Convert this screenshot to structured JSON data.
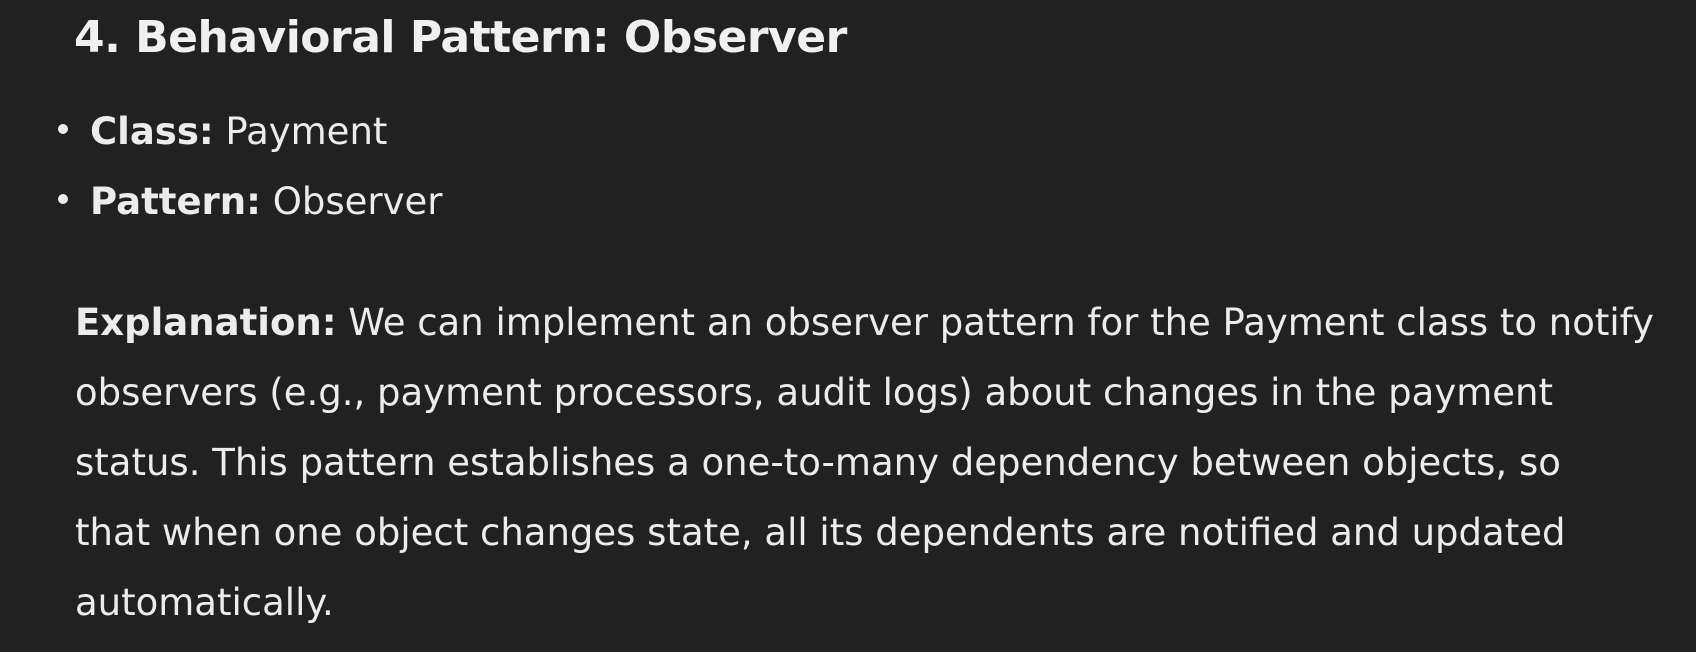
{
  "heading": "4. Behavioral Pattern: Observer",
  "bullets": [
    {
      "label": "Class:",
      "value": " Payment"
    },
    {
      "label": "Pattern:",
      "value": " Observer"
    }
  ],
  "explanation": {
    "label": "Explanation:",
    "lines": [
      " We can implement an observer pattern for the Payment class to notify",
      "observers (e.g., payment processors, audit logs) about changes in the payment",
      "status. This pattern establishes a one-to-many dependency between objects, so",
      "that when one object changes state, all its dependents are notified and updated",
      "automatically."
    ]
  }
}
